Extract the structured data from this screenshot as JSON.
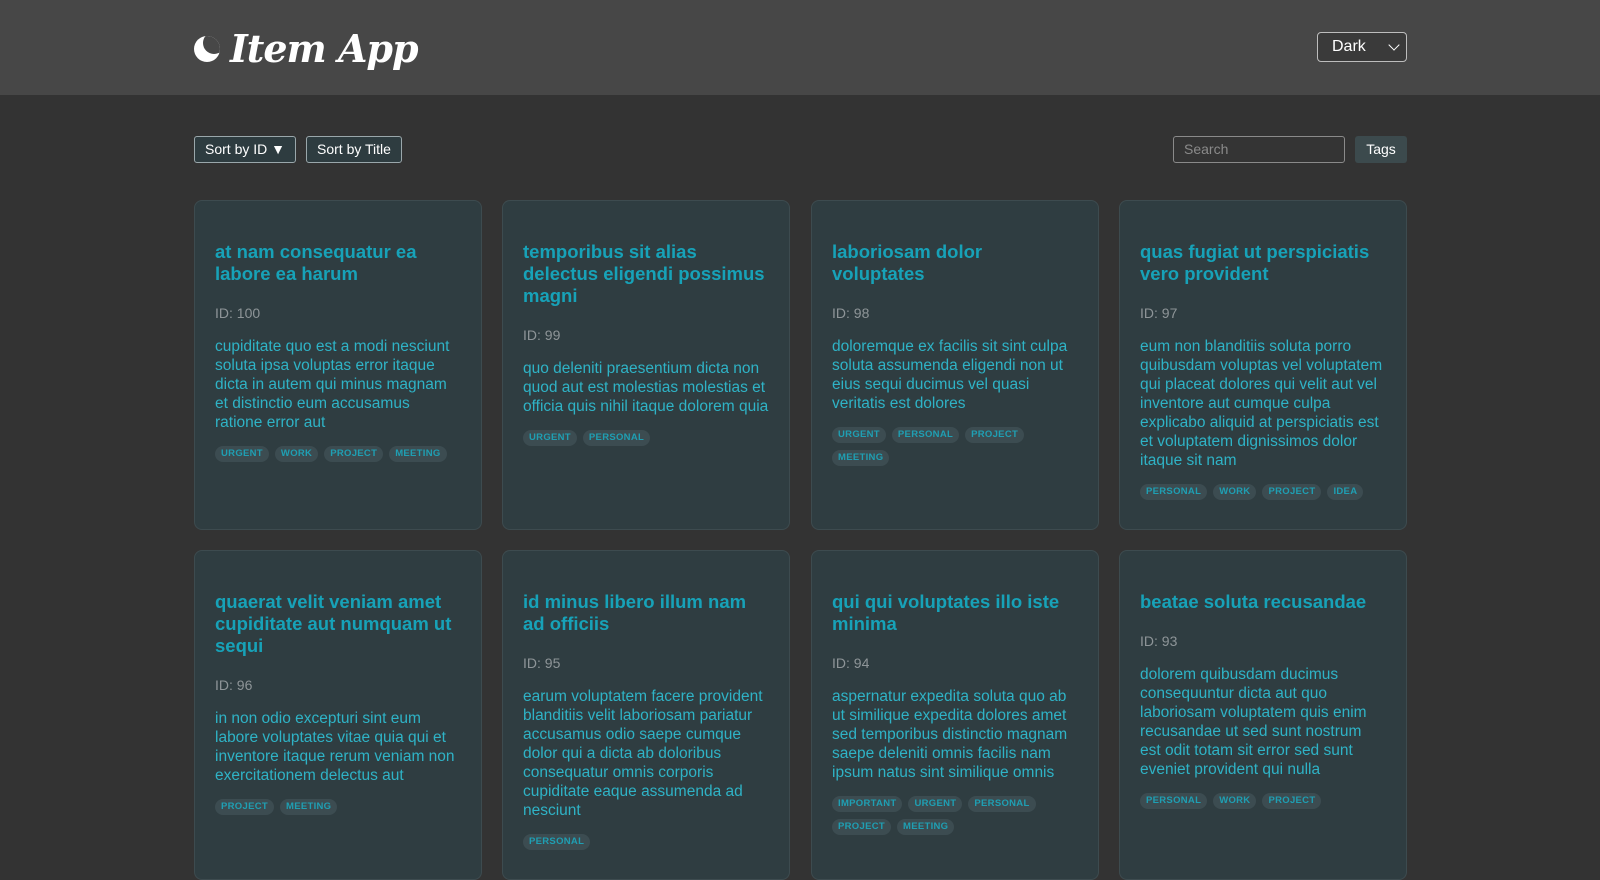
{
  "header": {
    "app_title": "Item App",
    "moon_icon": "crescent-moon-icon",
    "theme_select": {
      "value": "Dark"
    }
  },
  "toolbar": {
    "sort_by_id_label": "Sort by ID ▼",
    "sort_by_title_label": "Sort by Title",
    "search_placeholder": "Search",
    "tags_label": "Tags"
  },
  "colors": {
    "header_bg": "#474747",
    "page_bg": "#333333",
    "card_bg": "#2f3d41",
    "accent": "#17a2b8"
  },
  "cards": [
    {
      "title": "at nam consequatur ea labore ea harum",
      "id_label": "ID: 100",
      "body": "cupiditate quo est a modi nesciunt soluta ipsa voluptas error itaque dicta in autem qui minus magnam et distinctio eum accusamus ratione error aut",
      "tags": [
        "URGENT",
        "WORK",
        "PROJECT",
        "MEETING"
      ]
    },
    {
      "title": "temporibus sit alias delectus eligendi possimus magni",
      "id_label": "ID: 99",
      "body": "quo deleniti praesentium dicta non quod aut est molestias molestias et officia quis nihil itaque dolorem quia",
      "tags": [
        "URGENT",
        "PERSONAL"
      ]
    },
    {
      "title": "laboriosam dolor voluptates",
      "id_label": "ID: 98",
      "body": "doloremque ex facilis sit sint culpa soluta assumenda eligendi non ut eius sequi ducimus vel quasi veritatis est dolores",
      "tags": [
        "URGENT",
        "PERSONAL",
        "PROJECT",
        "MEETING"
      ]
    },
    {
      "title": "quas fugiat ut perspiciatis vero provident",
      "id_label": "ID: 97",
      "body": "eum non blanditiis soluta porro quibusdam voluptas vel voluptatem qui placeat dolores qui velit aut vel inventore aut cumque culpa explicabo aliquid at perspiciatis est et voluptatem dignissimos dolor itaque sit nam",
      "tags": [
        "PERSONAL",
        "WORK",
        "PROJECT",
        "IDEA"
      ]
    },
    {
      "title": "quaerat velit veniam amet cupiditate aut numquam ut sequi",
      "id_label": "ID: 96",
      "body": "in non odio excepturi sint eum labore voluptates vitae quia qui et inventore itaque rerum veniam non exercitationem delectus aut",
      "tags": [
        "PROJECT",
        "MEETING"
      ]
    },
    {
      "title": "id minus libero illum nam ad officiis",
      "id_label": "ID: 95",
      "body": "earum voluptatem facere provident blanditiis velit laboriosam pariatur accusamus odio saepe cumque dolor qui a dicta ab doloribus consequatur omnis corporis cupiditate eaque assumenda ad nesciunt",
      "tags": [
        "PERSONAL"
      ]
    },
    {
      "title": "qui qui voluptates illo iste minima",
      "id_label": "ID: 94",
      "body": "aspernatur expedita soluta quo ab ut similique expedita dolores amet sed temporibus distinctio magnam saepe deleniti omnis facilis nam ipsum natus sint similique omnis",
      "tags": [
        "IMPORTANT",
        "URGENT",
        "PERSONAL",
        "PROJECT",
        "MEETING"
      ]
    },
    {
      "title": "beatae soluta recusandae",
      "id_label": "ID: 93",
      "body": "dolorem quibusdam ducimus consequuntur dicta aut quo laboriosam voluptatem quis enim recusandae ut sed sunt nostrum est odit totam sit error sed sunt eveniet provident qui nulla",
      "tags": [
        "PERSONAL",
        "WORK",
        "PROJECT"
      ]
    }
  ]
}
